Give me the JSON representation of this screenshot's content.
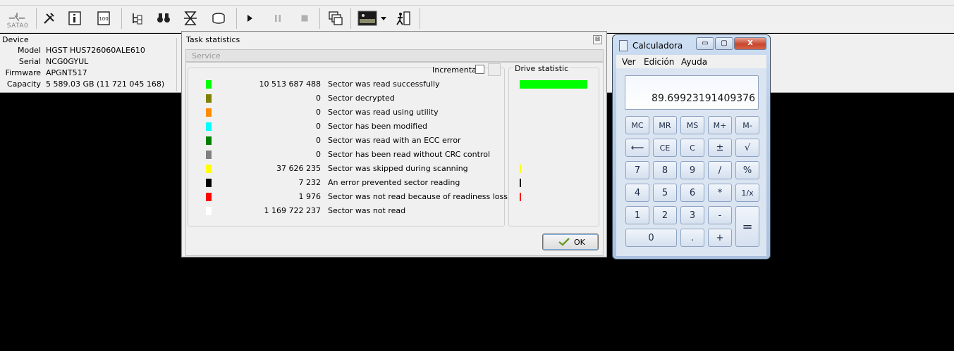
{
  "toolbar": {
    "sata_label": "SATA0",
    "buttons": [
      "port-icon",
      "tools-icon",
      "sn-info-icon",
      "percent-icon",
      "tree-icon",
      "binoculars-icon",
      "hourglass-icon",
      "drive-icon",
      "play-icon",
      "pause-icon",
      "stop-icon",
      "windows-icon",
      "image-icon",
      "dropdown-icon",
      "exit-icon"
    ]
  },
  "device": {
    "title": "Device",
    "rows": [
      {
        "key": "Model",
        "value": "HGST HUS726060ALE610"
      },
      {
        "key": "Serial",
        "value": "NCG0GYUL"
      },
      {
        "key": "Firmware",
        "value": "APGNT517"
      },
      {
        "key": "Capacity",
        "value": "5 589.03 GB (11 721 045 168)"
      }
    ]
  },
  "task_stats": {
    "title": "Task statistics",
    "service_label": "Service",
    "incremental_label": "Incremental",
    "drive_statistic_label": "Drive statistic",
    "ok_label": "OK",
    "close_glyph": "⊠",
    "rows": [
      {
        "color": "#00ff00",
        "value": "10 513 687 488",
        "label": "Sector was read successfully"
      },
      {
        "color": "#808000",
        "value": "0",
        "label": "Sector decrypted"
      },
      {
        "color": "#ff8c00",
        "value": "0",
        "label": "Sector was read using utility"
      },
      {
        "color": "#00ffff",
        "value": "0",
        "label": "Sector has been modified"
      },
      {
        "color": "#008000",
        "value": "0",
        "label": "Sector was read with an ECC error"
      },
      {
        "color": "#808080",
        "value": "0",
        "label": "Sector has been read without CRC control"
      },
      {
        "color": "#ffff00",
        "value": "37 626 235",
        "label": "Sector was skipped during scanning"
      },
      {
        "color": "#000000",
        "value": "7 232",
        "label": "An error prevented sector reading"
      },
      {
        "color": "#ff0000",
        "value": "1 976",
        "label": "Sector was not read because of readiness loss"
      },
      {
        "color": "#ffffff",
        "value": "1 169 722 237",
        "label": "Sector was not read"
      }
    ]
  },
  "calculator": {
    "title": "Calculadora",
    "menu": [
      "Ver",
      "Edición",
      "Ayuda"
    ],
    "display": "89.69923191409376",
    "window_buttons": {
      "min": "▭",
      "max": "▢",
      "close": "X"
    },
    "keys": {
      "mc": "MC",
      "mr": "MR",
      "ms": "MS",
      "mplus": "M+",
      "mminus": "M-",
      "back": "⟵",
      "ce": "CE",
      "c": "C",
      "pm": "±",
      "sqrt": "√",
      "k7": "7",
      "k8": "8",
      "k9": "9",
      "div": "/",
      "pct": "%",
      "k4": "4",
      "k5": "5",
      "k6": "6",
      "mul": "*",
      "inv": "1/x",
      "k1": "1",
      "k2": "2",
      "k3": "3",
      "sub": "-",
      "eq": "=",
      "k0": "0",
      "dot": ".",
      "add": "+"
    }
  }
}
